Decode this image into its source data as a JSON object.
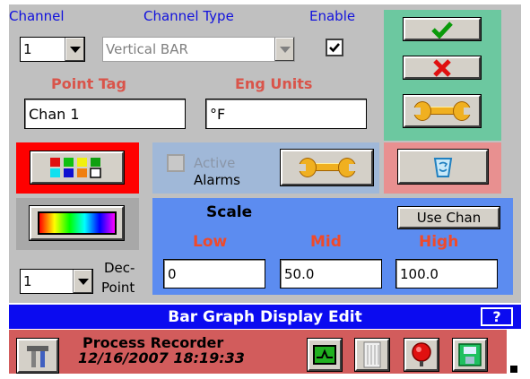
{
  "labels": {
    "channel": "Channel",
    "channel_type": "Channel Type",
    "enable": "Enable",
    "point_tag": "Point Tag",
    "eng_units": "Eng Units",
    "active": "Active",
    "alarms": "Alarms",
    "scale": "Scale",
    "use_chan": "Use Chan",
    "low": "Low",
    "mid": "Mid",
    "high": "High",
    "dec_point_1": "Dec-",
    "dec_point_2": "Point"
  },
  "fields": {
    "channel_value": "1",
    "channel_type_value": "Vertical BAR",
    "enable_checked": true,
    "point_tag_value": "Chan 1",
    "eng_units_value": "°F",
    "active_alarms_checked": false,
    "scale_low": "0",
    "scale_mid": "50.0",
    "scale_high": "100.0",
    "dec_point_value": "1"
  },
  "status_bar": {
    "title": "Bar Graph Display Edit",
    "help": "?"
  },
  "taskbar": {
    "app_name": "Process Recorder",
    "datetime": "12/16/2007 18:19:33"
  },
  "colors": {
    "panel_bg": "#c0c0c0",
    "action_green": "#6cc8a0",
    "palette_red": "#ff0000",
    "delete_pink": "#e89090",
    "alarms_blue": "#a0b8d8",
    "scale_blue": "#5c8cf0",
    "status_blue": "#0b0bf0",
    "taskbar_red": "#d25c5c",
    "label_blue": "#1111dd",
    "label_red": "#d9544a"
  },
  "icons": {
    "ok": "checkmark-icon",
    "cancel": "red-x-icon",
    "settings": "wrench-icon",
    "palette": "color-grid-icon",
    "gradient": "rainbow-gradient-icon",
    "delete": "recycle-bin-icon",
    "help": "question-mark-icon"
  }
}
